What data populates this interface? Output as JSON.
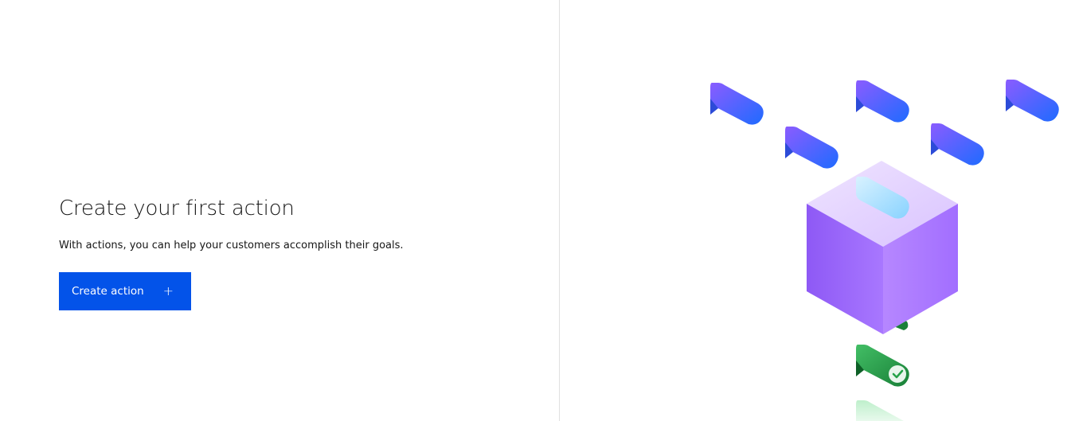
{
  "empty_state": {
    "title": "Create your first action",
    "description": "With actions, you can help your customers accomplish their goals.",
    "create_button": {
      "label": "Create action",
      "icon": "plus-icon"
    }
  },
  "illustration": {
    "name": "actions-cube-illustration",
    "colors": {
      "chat_blue": "#0f62fe",
      "chat_violet": "#8a3ffc",
      "cube_top": "#e8d9ff",
      "cube_left": "#9e6bff",
      "cube_right": "#b48aff",
      "check_green": "#24a148"
    }
  },
  "theme": {
    "primary": "#0353e9",
    "divider": "#e0e0e0",
    "text": "#161616"
  }
}
